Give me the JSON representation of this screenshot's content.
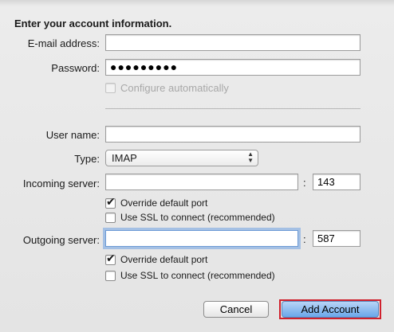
{
  "form": {
    "heading": "Enter your account information.",
    "email": {
      "label": "E-mail address:",
      "value": ""
    },
    "password": {
      "label": "Password:",
      "value": "●●●●●●●●●"
    },
    "configure_auto": {
      "label": "Configure automatically",
      "checked": false,
      "enabled": false
    },
    "username": {
      "label": "User name:",
      "value": ""
    },
    "type": {
      "label": "Type:",
      "selected": "IMAP"
    },
    "incoming": {
      "label": "Incoming server:",
      "value": "",
      "port": "143",
      "override_port": {
        "label": "Override default port",
        "checked": true
      },
      "use_ssl": {
        "label": "Use SSL to connect (recommended)",
        "checked": false
      }
    },
    "outgoing": {
      "label": "Outgoing server:",
      "value": "",
      "port": "587",
      "override_port": {
        "label": "Override default port",
        "checked": true
      },
      "use_ssl": {
        "label": "Use SSL to connect (recommended)",
        "checked": false
      }
    },
    "colon": ":",
    "check_mark": "✔"
  },
  "buttons": {
    "cancel": "Cancel",
    "add_account": "Add Account"
  }
}
